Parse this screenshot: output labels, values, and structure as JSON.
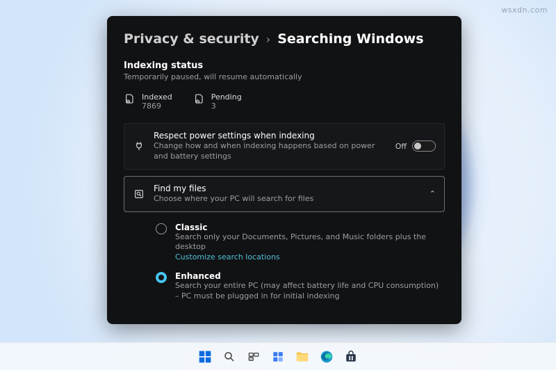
{
  "watermark": "wsxdn.com",
  "breadcrumb": {
    "parent": "Privacy & security",
    "separator": "›",
    "current": "Searching Windows"
  },
  "indexing": {
    "title": "Indexing status",
    "subtitle": "Temporarily paused, will resume automatically",
    "stats": {
      "indexed": {
        "label": "Indexed",
        "value": "7869"
      },
      "pending": {
        "label": "Pending",
        "value": "3"
      }
    }
  },
  "power": {
    "title": "Respect power settings when indexing",
    "subtitle": "Change how and when indexing happens based on power and battery settings",
    "state": "Off"
  },
  "find": {
    "title": "Find my files",
    "subtitle": "Choose where your PC will search for files",
    "options": {
      "classic": {
        "title": "Classic",
        "desc": "Search only your Documents, Pictures, and Music folders plus the desktop",
        "link": "Customize search locations"
      },
      "enhanced": {
        "title": "Enhanced",
        "desc": "Search your entire PC (may affect battery life and CPU consumption) – PC must be plugged in for initial indexing"
      },
      "selected": "enhanced"
    }
  },
  "taskbar": {
    "items": [
      "start",
      "search",
      "task-view",
      "widgets",
      "file-explorer",
      "edge",
      "store"
    ]
  }
}
